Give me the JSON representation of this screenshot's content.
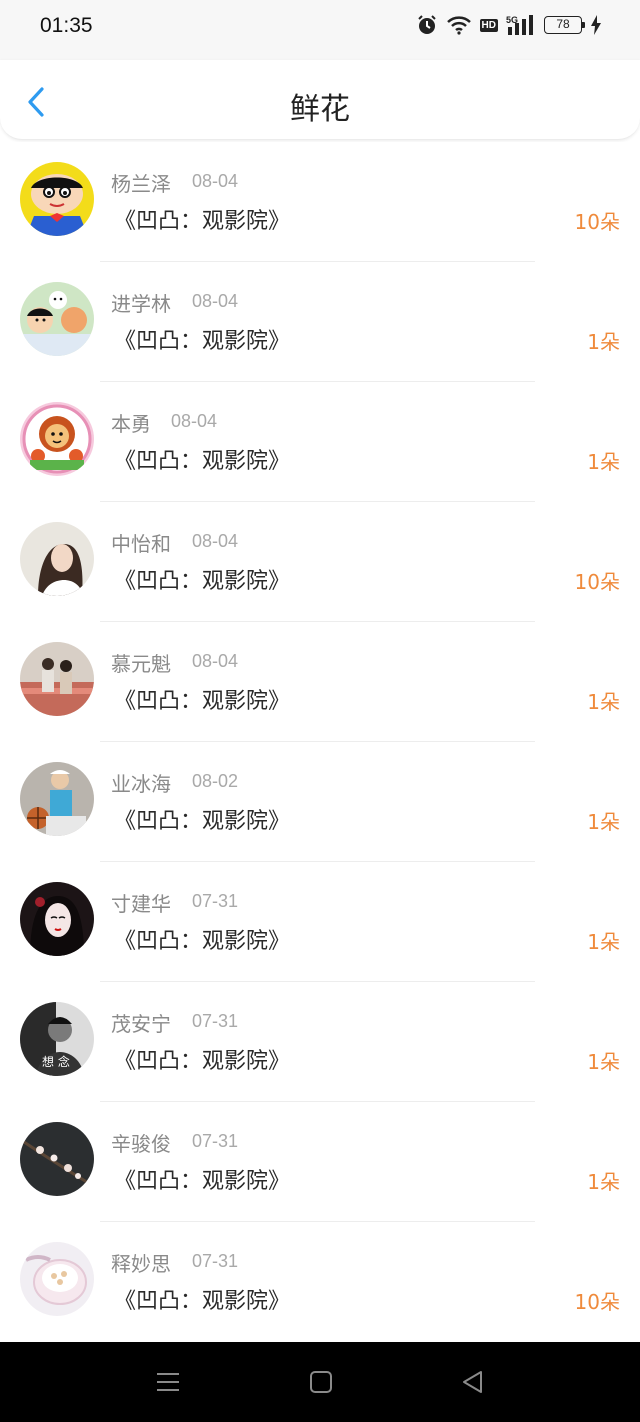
{
  "status_bar": {
    "time": "01:35",
    "hd": "HD",
    "battery": "78"
  },
  "header": {
    "title": "鲜花"
  },
  "items": [
    {
      "name": "杨兰泽",
      "date": "08-04",
      "work": "《凹凸：观影院》",
      "flowers": "10朵",
      "avatar": "cartoon-boy-avatar"
    },
    {
      "name": "进学林",
      "date": "08-04",
      "work": "《凹凸：观影院》",
      "flowers": "1朵",
      "avatar": "cartoon-group-avatar"
    },
    {
      "name": "本勇",
      "date": "08-04",
      "work": "《凹凸：观影院》",
      "flowers": "1朵",
      "avatar": "lion-cartoon-avatar"
    },
    {
      "name": "中怡和",
      "date": "08-04",
      "work": "《凹凸：观影院》",
      "flowers": "10朵",
      "avatar": "girl-photo-avatar"
    },
    {
      "name": "慕元魁",
      "date": "08-04",
      "work": "《凹凸：观影院》",
      "flowers": "1朵",
      "avatar": "couple-photo-avatar"
    },
    {
      "name": "业冰海",
      "date": "08-02",
      "work": "《凹凸：观影院》",
      "flowers": "1朵",
      "avatar": "basketball-boy-avatar"
    },
    {
      "name": "寸建华",
      "date": "07-31",
      "work": "《凹凸：观影院》",
      "flowers": "1朵",
      "avatar": "anime-girl-avatar"
    },
    {
      "name": "茂安宁",
      "date": "07-31",
      "work": "《凹凸：观影院》",
      "flowers": "1朵",
      "avatar": "bw-portrait-avatar"
    },
    {
      "name": "辛骏俊",
      "date": "07-31",
      "work": "《凹凸：观影院》",
      "flowers": "1朵",
      "avatar": "plum-blossom-avatar"
    },
    {
      "name": "释妙思",
      "date": "07-31",
      "work": "《凹凸：观影院》",
      "flowers": "10朵",
      "avatar": "jewelry-box-avatar"
    }
  ],
  "colors": {
    "accent_blue": "#2e9bf0",
    "flower_orange": "#ef8a3b",
    "name_gray": "#8a8a8a"
  }
}
